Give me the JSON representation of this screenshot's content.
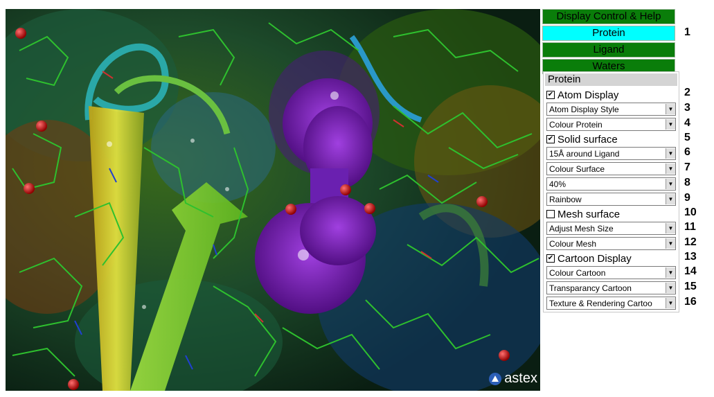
{
  "viewer": {
    "logo_text": "astex",
    "colors": {
      "surface": "#6b1fa8",
      "strand_yellow": "#d8c020",
      "strand_green": "#88e030",
      "helix": "#2aa8a8",
      "water": "#cc1010"
    }
  },
  "top_menu": {
    "title": "Display Control & Help",
    "items": [
      "Protein",
      "Ligand",
      "Waters"
    ],
    "active": "Protein",
    "active_color": "#00ffff",
    "inactive_color": "#0a7d0a"
  },
  "protein_panel": {
    "title": "Protein",
    "atom_display": {
      "label": "Atom Display",
      "checked": true
    },
    "atom_display_style": "Atom Display Style",
    "colour_protein": "Colour Protein",
    "solid_surface": {
      "label": "Solid surface",
      "checked": true
    },
    "surface_range": "15Å around Ligand",
    "colour_surface": "Colour Surface",
    "transparency": "40%",
    "colour_scheme": "Rainbow",
    "mesh_surface": {
      "label": "Mesh surface",
      "checked": false
    },
    "adjust_mesh": "Adjust Mesh Size",
    "colour_mesh": "Colour Mesh",
    "cartoon_display": {
      "label": "Cartoon Display",
      "checked": true
    },
    "colour_cartoon": "Colour Cartoon",
    "transparency_cartoon": "Transparancy Cartoon",
    "texture_rendering": "Texture & Rendering Cartoo"
  },
  "callouts": [
    "1",
    "2",
    "3",
    "4",
    "5",
    "6",
    "7",
    "8",
    "9",
    "10",
    "11",
    "12",
    "13",
    "14",
    "15",
    "16"
  ]
}
